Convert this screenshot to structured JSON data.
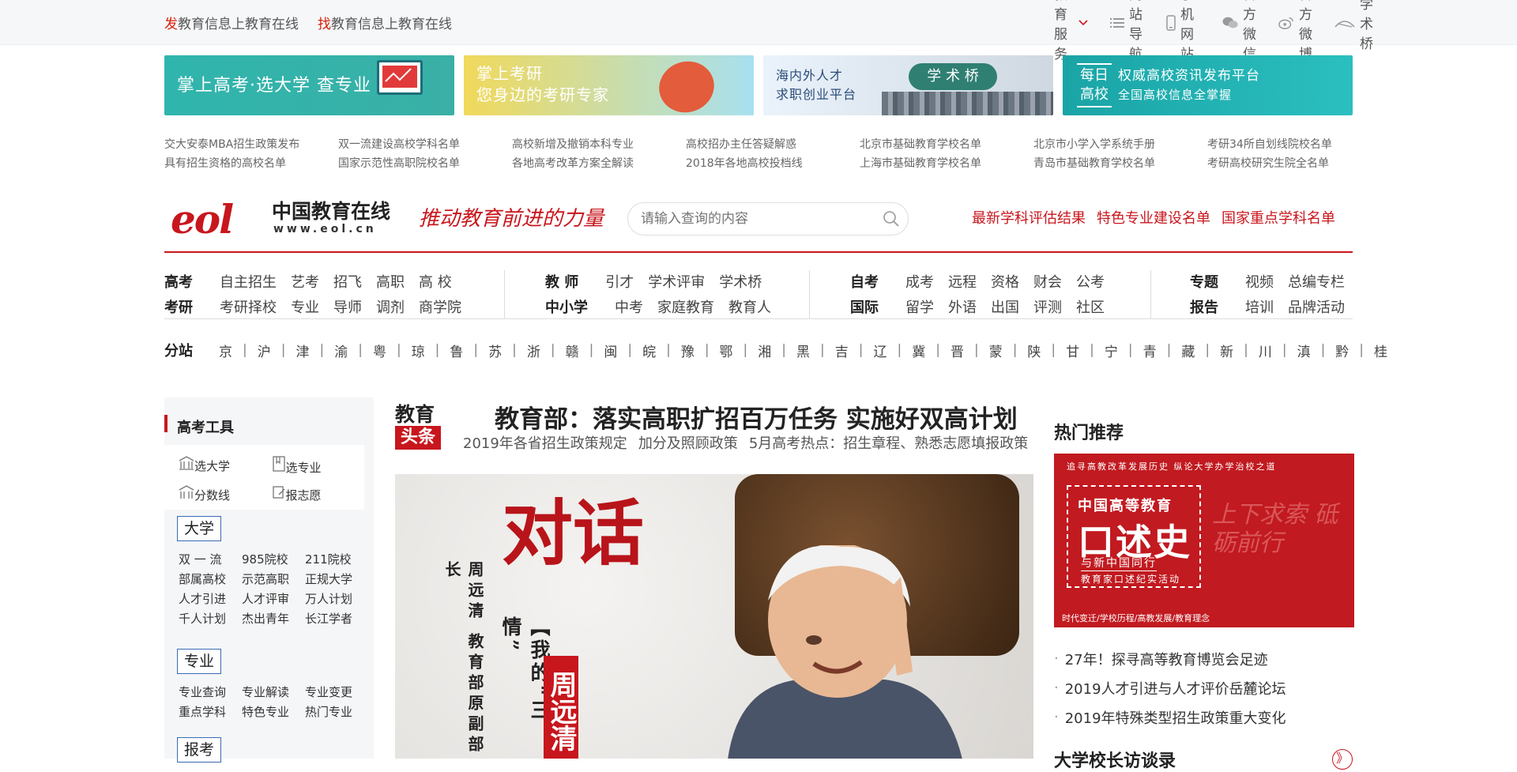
{
  "topbar": {
    "left": [
      {
        "red": "发",
        "text": "教育信息上教育在线"
      },
      {
        "red": "找",
        "text": "教育信息上教育在线"
      }
    ],
    "right": [
      {
        "icon": "chevron-down-icon",
        "label": "教育服务"
      },
      {
        "icon": "list-icon",
        "label": "网站导航"
      },
      {
        "icon": "phone-icon",
        "label": "手机网站"
      },
      {
        "icon": "wechat-icon",
        "label": "官方微信"
      },
      {
        "icon": "weibo-icon",
        "label": "官方微博"
      },
      {
        "icon": "bridge-icon",
        "label": "学术桥"
      }
    ]
  },
  "banners": [
    {
      "text": "掌上高考·选大学 查专业"
    },
    {
      "line1": "掌上考研",
      "line2": "您身边的考研专家"
    },
    {
      "line1": "海内外人才",
      "line2": "求职创业平台",
      "logo": "学 术 桥"
    },
    {
      "badge1": "每日",
      "badge2": "高校",
      "line1": "权威高校资讯发布平台",
      "line2": "全国高校信息全掌握"
    }
  ],
  "quick_links": [
    "交大安泰MBA招生政策发布",
    "双一流建设高校学科名单",
    "高校新增及撤销本科专业",
    "高校招办主任答疑解惑",
    "北京市基础教育学校名单",
    "北京市小学入学系统手册",
    "考研34所自划线院校名单",
    "具有招生资格的高校名单",
    "国家示范性高职院校名单",
    "各地高考改革方案全解读",
    "2018年各地高校投档线",
    "上海市基础教育学校名单",
    "青岛市基础教育学校名单",
    "考研高校研究生院全名单"
  ],
  "header": {
    "logo_cn": "中国教育在线",
    "logo_url": "www.eol.cn",
    "logo_mark": "eol",
    "slogan": "推动教育前进的力量",
    "search_placeholder": "请输入查询的内容",
    "hot_links": [
      "最新学科评估结果",
      "特色专业建设名单",
      "国家重点学科名单"
    ]
  },
  "nav": {
    "col1": {
      "row1": {
        "head": "高考",
        "items": [
          "自主招生",
          "艺考",
          "招飞",
          "高职",
          "高 校"
        ]
      },
      "row2": {
        "head": "考研",
        "items": [
          "考研择校",
          "专业",
          "导师",
          "调剂",
          "商学院"
        ]
      }
    },
    "col2": {
      "row1": {
        "head": "教 师",
        "items": [
          "引才",
          "学术评审",
          "学术桥"
        ]
      },
      "row2": {
        "head": "中小学",
        "items": [
          "中考",
          "家庭教育",
          "教育人"
        ]
      }
    },
    "col3": {
      "row1": {
        "head": "自考",
        "items": [
          "成考",
          "远程",
          "资格",
          "财会",
          "公考"
        ]
      },
      "row2": {
        "head": "国际",
        "items": [
          "留学",
          "外语",
          "出国",
          "评测",
          "社区"
        ]
      }
    },
    "col4": {
      "row1": {
        "head": "专题",
        "items": [
          "视频",
          "总编专栏"
        ]
      },
      "row2": {
        "head": "报告",
        "items": [
          "培训",
          "品牌活动"
        ]
      }
    }
  },
  "fenzhan": {
    "label": "分站",
    "items": [
      "京",
      "沪",
      "津",
      "渝",
      "粤",
      "琼",
      "鲁",
      "苏",
      "浙",
      "赣",
      "闽",
      "皖",
      "豫",
      "鄂",
      "湘",
      "黑",
      "吉",
      "辽",
      "冀",
      "晋",
      "蒙",
      "陕",
      "甘",
      "宁",
      "青",
      "藏",
      "新",
      "川",
      "滇",
      "黔",
      "桂"
    ]
  },
  "sidebar": {
    "title": "高考工具",
    "tools": [
      {
        "icon": "building-icon",
        "label": "选大学"
      },
      {
        "icon": "book-icon",
        "label": "选专业"
      },
      {
        "icon": "chart-icon",
        "label": "分数线"
      },
      {
        "icon": "form-icon",
        "label": "报志愿"
      }
    ],
    "daxue": {
      "label": "大学",
      "items": [
        "双 一 流",
        "985院校",
        "211院校",
        "部属高校",
        "示范高职",
        "正规大学",
        "人才引进",
        "人才评审",
        "万人计划",
        "千人计划",
        "杰出青年",
        "长江学者"
      ]
    },
    "zhuanye": {
      "label": "专业",
      "items": [
        "专业查询",
        "专业解读",
        "专业变更",
        "重点学科",
        "特色专业",
        "热门专业"
      ]
    },
    "baokao": {
      "label": "报考"
    }
  },
  "headline": {
    "badge_top": "教育",
    "badge_bottom": "头条",
    "title": "教育部：落实高职扩招百万任务 实施好双高计划",
    "subs": [
      "2019年各省招生政策规定",
      "加分及照顾政策",
      "5月高考热点：招生章程、熟悉志愿填报政策"
    ]
  },
  "photo": {
    "big_text": "对话",
    "vertical1": "周远清 教育部原副部长",
    "vertical2": "【我的“三情”",
    "red_tag": "周远清"
  },
  "right": {
    "title": "热门推荐",
    "poster": {
      "top": "追寻高教改革发展历史  纵论大学办学治校之道",
      "line1": "中国高等教育",
      "line2": "口述史",
      "line3": "与新中国同行",
      "line4": "教育家口述纪实活动",
      "foot": "时代变迁/学校历程/高教发展/教育理念",
      "calli": "上下求索 砥砺前行"
    },
    "hot": [
      "27年！探寻高等教育博览会足迹",
      "2019人才引进与人才评价岳麓论坛",
      "2019年特殊类型招生政策重大变化"
    ],
    "title2": "大学校长访谈录",
    "more": "》"
  },
  "colors": {
    "accent": "#c8161d",
    "link_blue": "#3a6bb5"
  }
}
